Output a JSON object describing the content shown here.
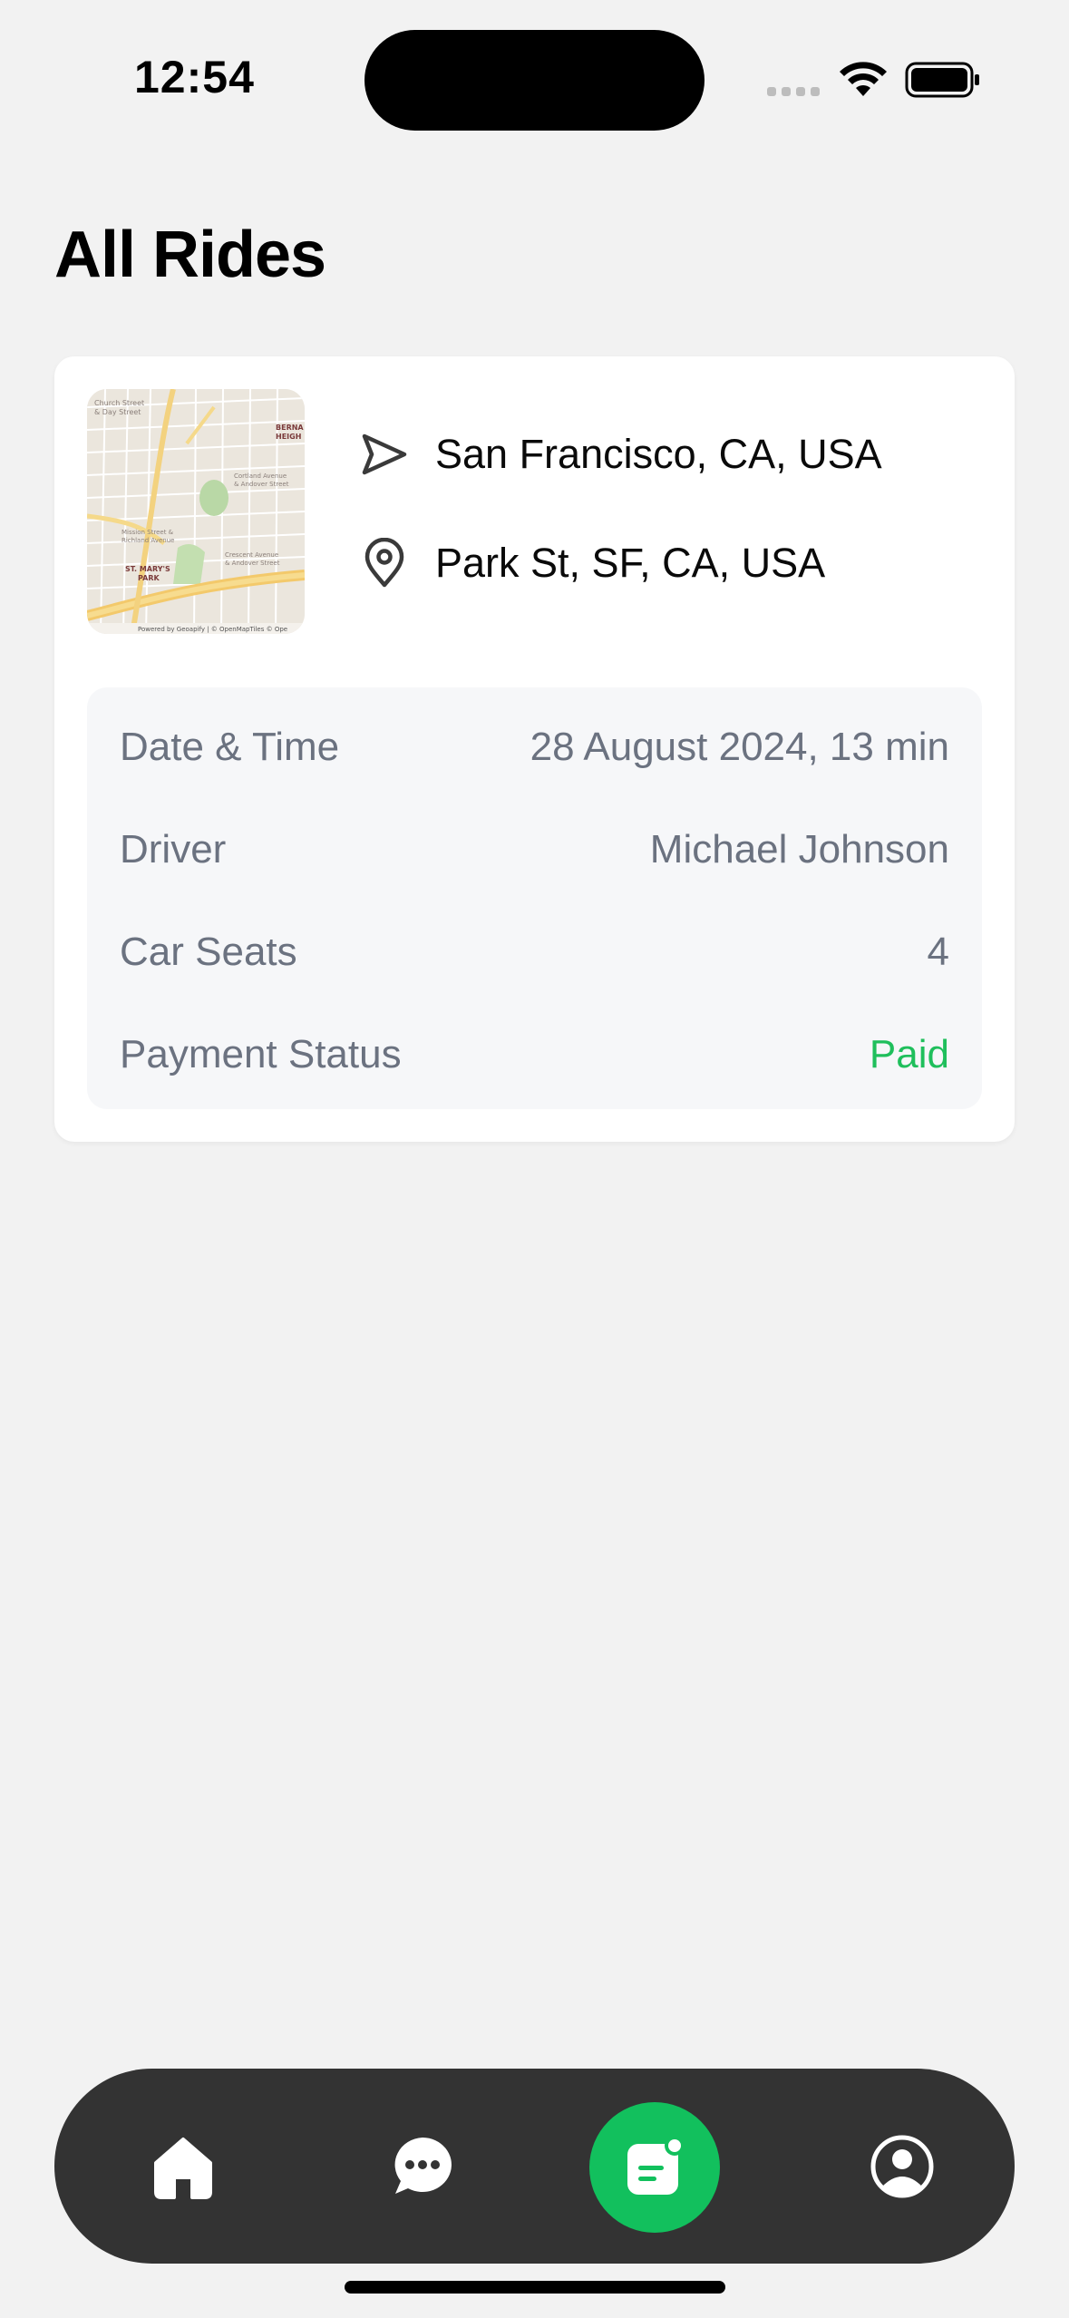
{
  "status_bar": {
    "time": "12:54"
  },
  "page": {
    "title": "All Rides"
  },
  "ride": {
    "from": "San Francisco, CA, USA",
    "to": "Park St, SF, CA, USA",
    "map_labels": {
      "church": "Church Street & Day Street",
      "bernal": "BERNAL HEIGHTS",
      "cortland": "Cortland Avenue & Andover Street",
      "mission": "Mission Street & Richland Avenue",
      "stmarys": "ST. MARY'S PARK",
      "crescent": "Crescent Avenue & Andover Street",
      "attribution": "Powered by Geoapify | © OpenMapTiles © OpenStreetMap"
    },
    "details": [
      {
        "label": "Date & Time",
        "value": "28 August 2024, 13 min"
      },
      {
        "label": "Driver",
        "value": "Michael Johnson"
      },
      {
        "label": "Car Seats",
        "value": "4"
      },
      {
        "label": "Payment Status",
        "value": "Paid"
      }
    ]
  },
  "nav": {
    "items": [
      "home-icon",
      "chat-icon",
      "rides-icon",
      "profile-icon"
    ],
    "active": "rides-icon"
  },
  "colors": {
    "accent": "#12c05d",
    "paid": "#1fbf5c",
    "nav_bg": "#333333",
    "page_bg": "#f2f2f2"
  }
}
